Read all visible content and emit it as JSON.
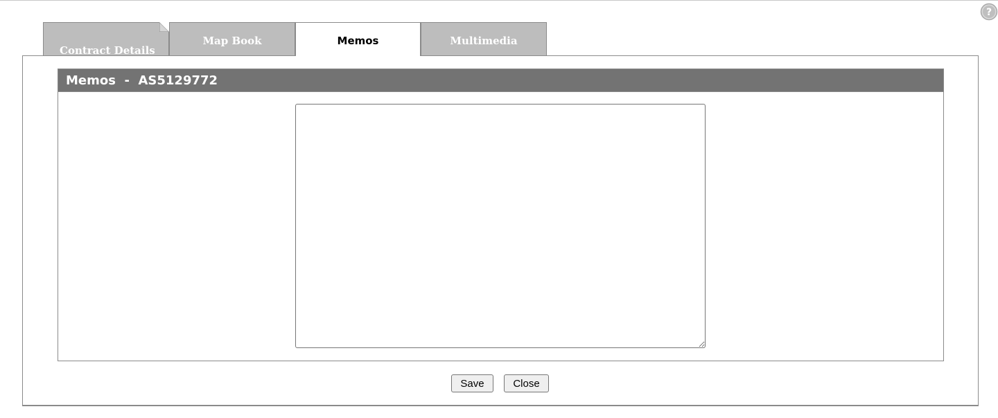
{
  "tabs": [
    {
      "label": "Contract Details",
      "active": false
    },
    {
      "label": "Map Book",
      "active": false
    },
    {
      "label": "Memos",
      "active": true
    },
    {
      "label": "Multimedia",
      "active": false
    }
  ],
  "memo": {
    "title": "Memos  -  AS5129772",
    "text": ""
  },
  "buttons": {
    "save": "Save",
    "close": "Close"
  },
  "icons": {
    "help": "help-circle-icon"
  },
  "colors": {
    "inactive_tab": "#bdbdbd",
    "header_bar": "#737373",
    "border": "#8a8a8a"
  }
}
